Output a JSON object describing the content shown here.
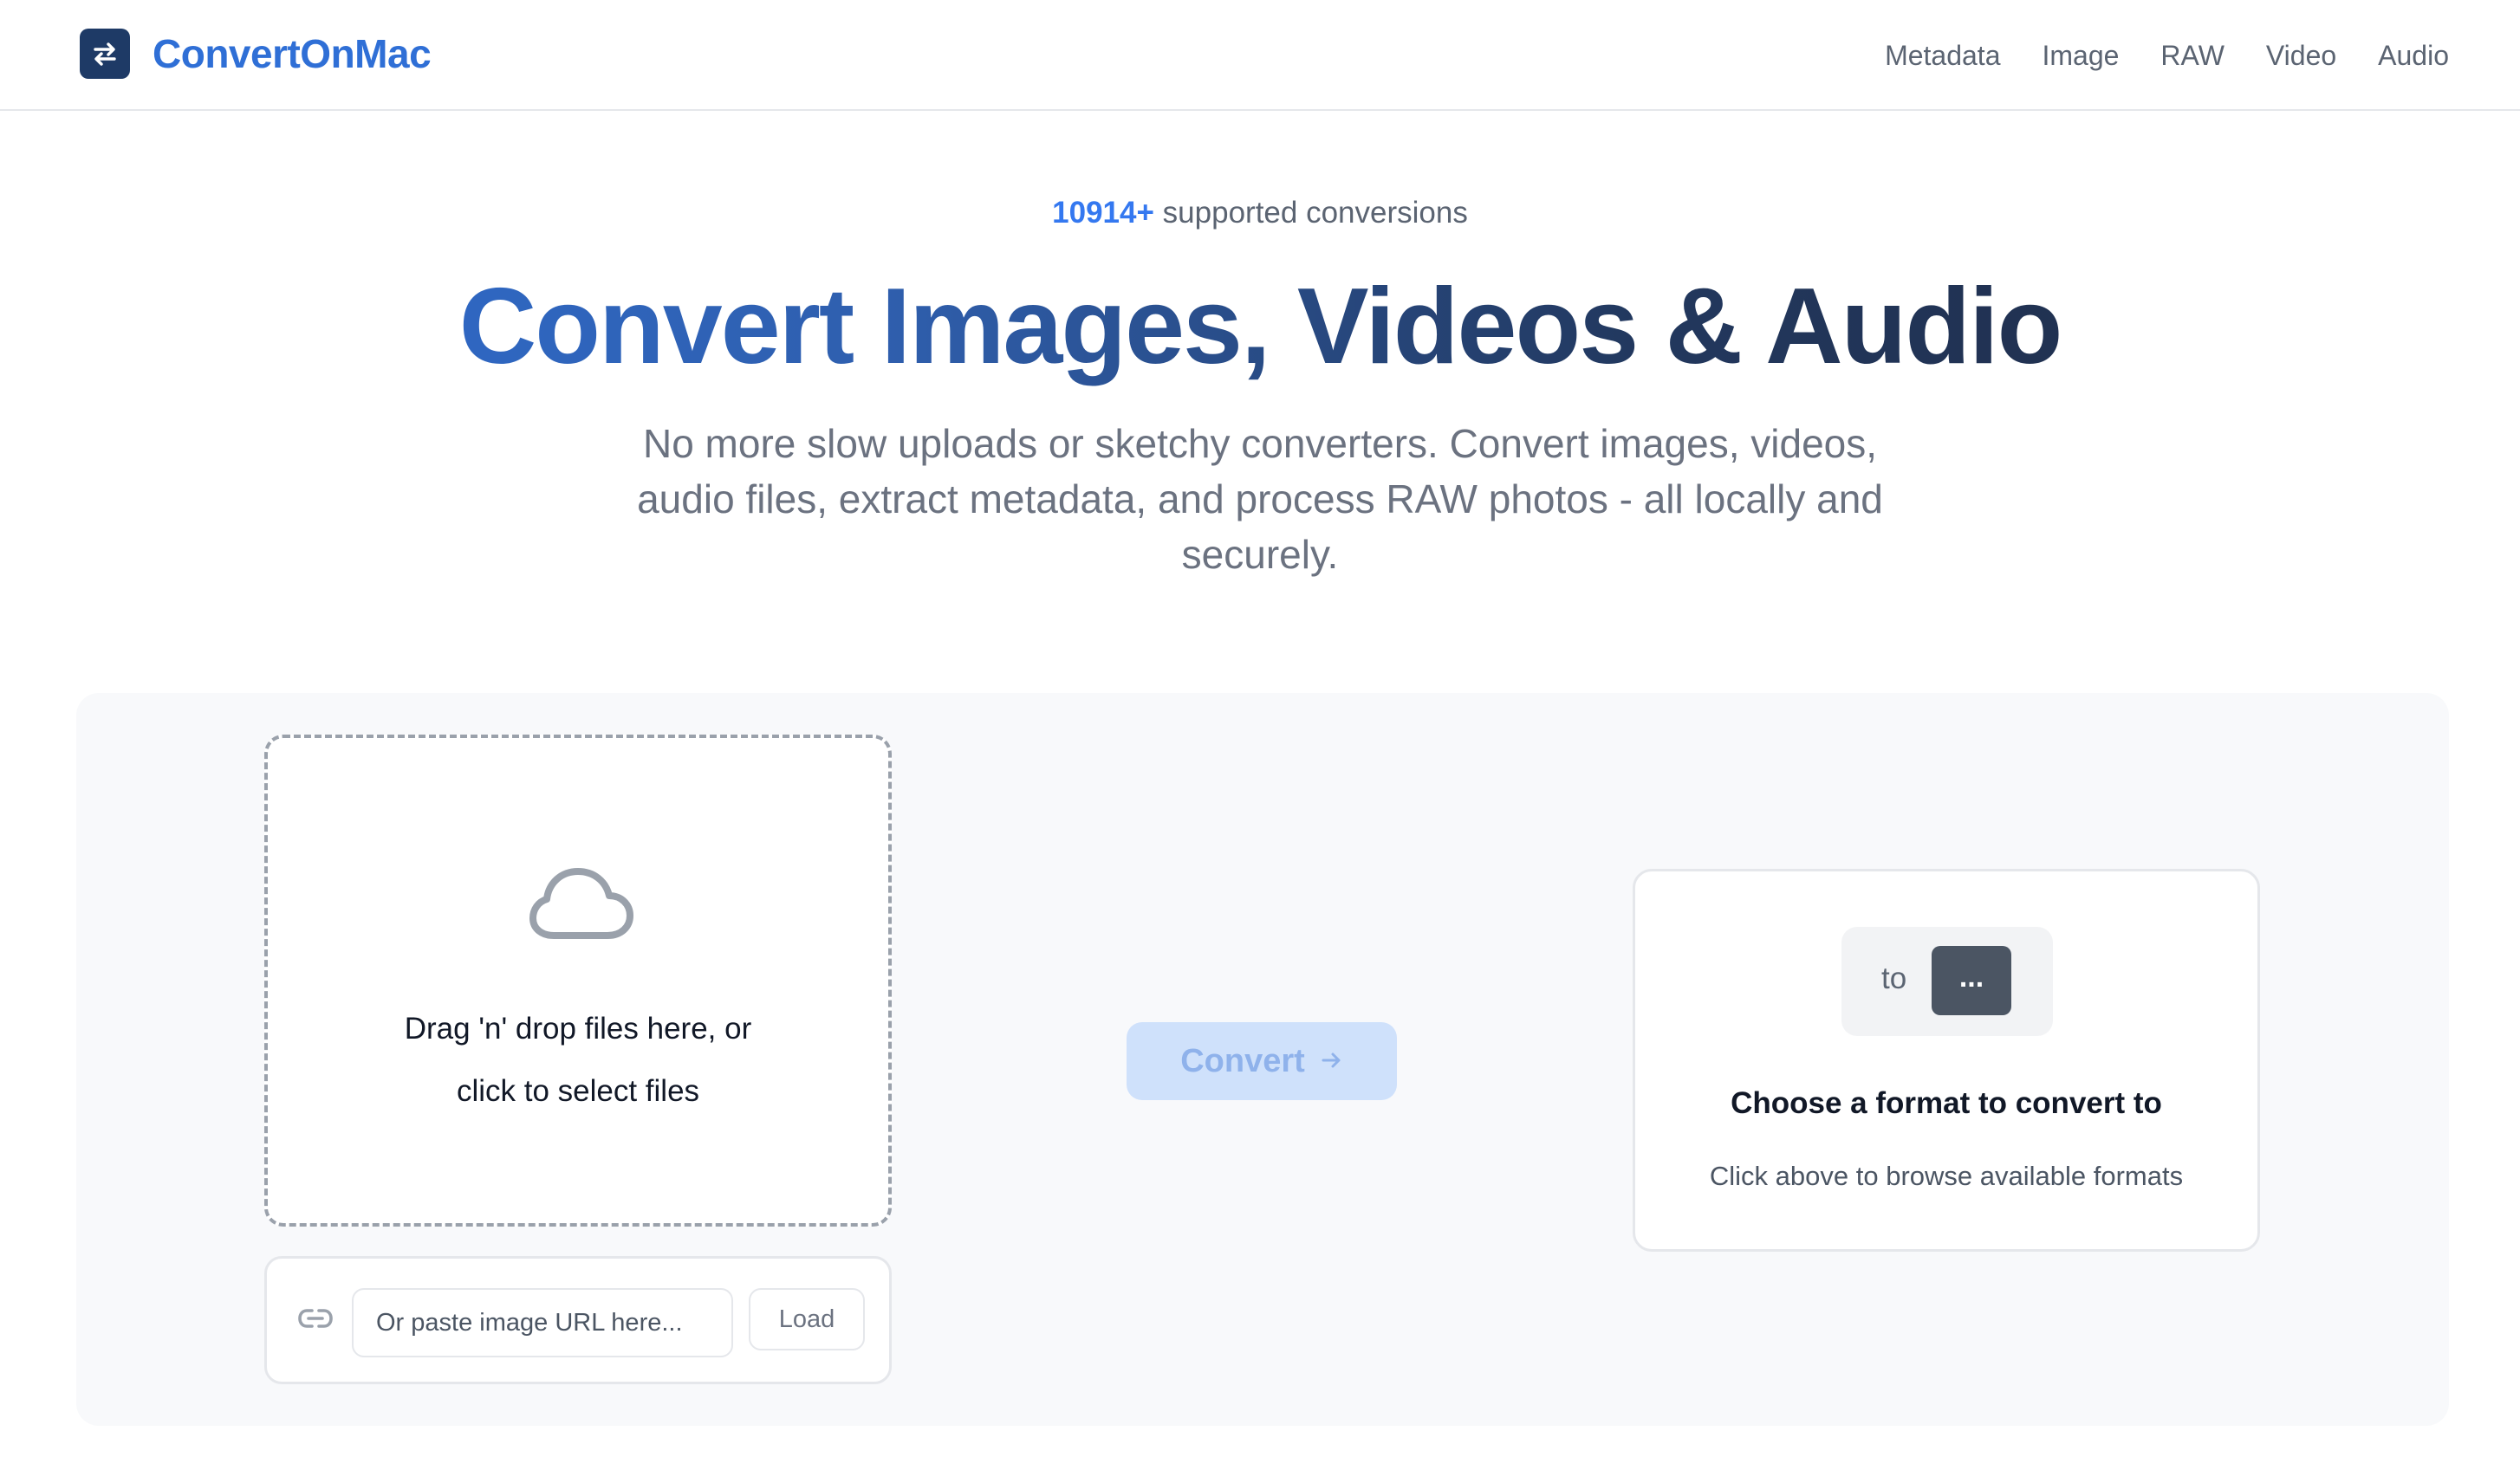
{
  "brand": {
    "name": "ConvertOnMac",
    "logo_icon": "swap-arrows-icon"
  },
  "nav": {
    "items": [
      {
        "label": "Metadata"
      },
      {
        "label": "Image"
      },
      {
        "label": "RAW"
      },
      {
        "label": "Video"
      },
      {
        "label": "Audio"
      }
    ]
  },
  "hero": {
    "count": "10914+",
    "count_suffix": "supported conversions",
    "headline": "Convert Images, Videos & Audio",
    "subtitle": "No more slow uploads or sketchy converters. Convert images, videos, audio files, extract metadata, and process RAW photos - all locally and securely."
  },
  "dropzone": {
    "icon": "cloud-icon",
    "line1": "Drag 'n' drop files here, or",
    "line2": "click to select files"
  },
  "url_loader": {
    "icon": "link-icon",
    "placeholder": "Or paste image URL here...",
    "value": "",
    "button_label": "Load"
  },
  "convert": {
    "label": "Convert",
    "icon": "arrow-right-icon",
    "state": "disabled"
  },
  "format": {
    "to_label": "to",
    "selected": "...",
    "title": "Choose a format to convert to",
    "hint": "Click above to browse available formats"
  },
  "colors": {
    "brand_blue": "#2f6fd6",
    "count_blue": "#3478f0",
    "convert_disabled_bg": "#cfe1fb",
    "logo_bg": "#1e3a66"
  }
}
